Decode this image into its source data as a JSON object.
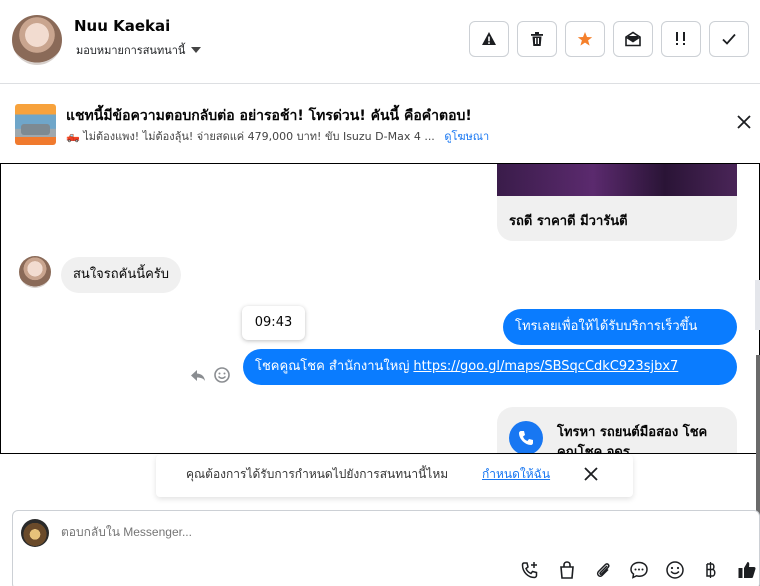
{
  "header": {
    "contact_name": "Nuu Kaekai",
    "assign_label": "มอบหมายการสนทนานี้",
    "actions": [
      "warning-icon",
      "trash-icon",
      "star-icon",
      "envelope-open-icon",
      "priority-icon",
      "check-icon"
    ],
    "accent": "#f5802b"
  },
  "ad": {
    "title": "แชทนี้มีข้อความตอบกลับต่อ อย่ารอช้า! โทรด่วน! คันนี้ คือคำตอบ!",
    "subtitle": "🛻 ไม่ต้องแพง! ไม่ต้องลุ้น! จ่ายสดแค่ 479,000 บาท! ขับ Isuzu D-Max 4 ...",
    "link": "ดูโฆษณา"
  },
  "chat": {
    "card_caption": "รถดี ราคาดี มีวารันตี",
    "incoming_message": "สนใจรถคันนี้ครับ",
    "outgoing_1": "โทรเลยเพื่อให้ได้รับบริการเร็วขึ้น",
    "outgoing_2_text": "โชคคูณโชค สำนักงานใหญ่",
    "outgoing_2_link": "https://goo.gl/maps/SBSqcCdkC923sjbx7",
    "timestamp": "09:43",
    "call_card_text": "โทรหา รถยนต์มือสอง โชคคูณโชค จดร",
    "bubble_color": "#0a7cff"
  },
  "prompt": {
    "text": "คุณต้องการได้รับการกำหนดไปยังการสนทนานี้ไหม",
    "link": "กำหนดให้ฉัน"
  },
  "composer": {
    "placeholder": "ตอบกลับใน Messenger...",
    "tools": [
      "add-call-icon",
      "shopping-bag-icon",
      "paperclip-icon",
      "chat-bubble-icon",
      "emoji-icon",
      "baht-icon",
      "thumbs-up-icon"
    ]
  }
}
